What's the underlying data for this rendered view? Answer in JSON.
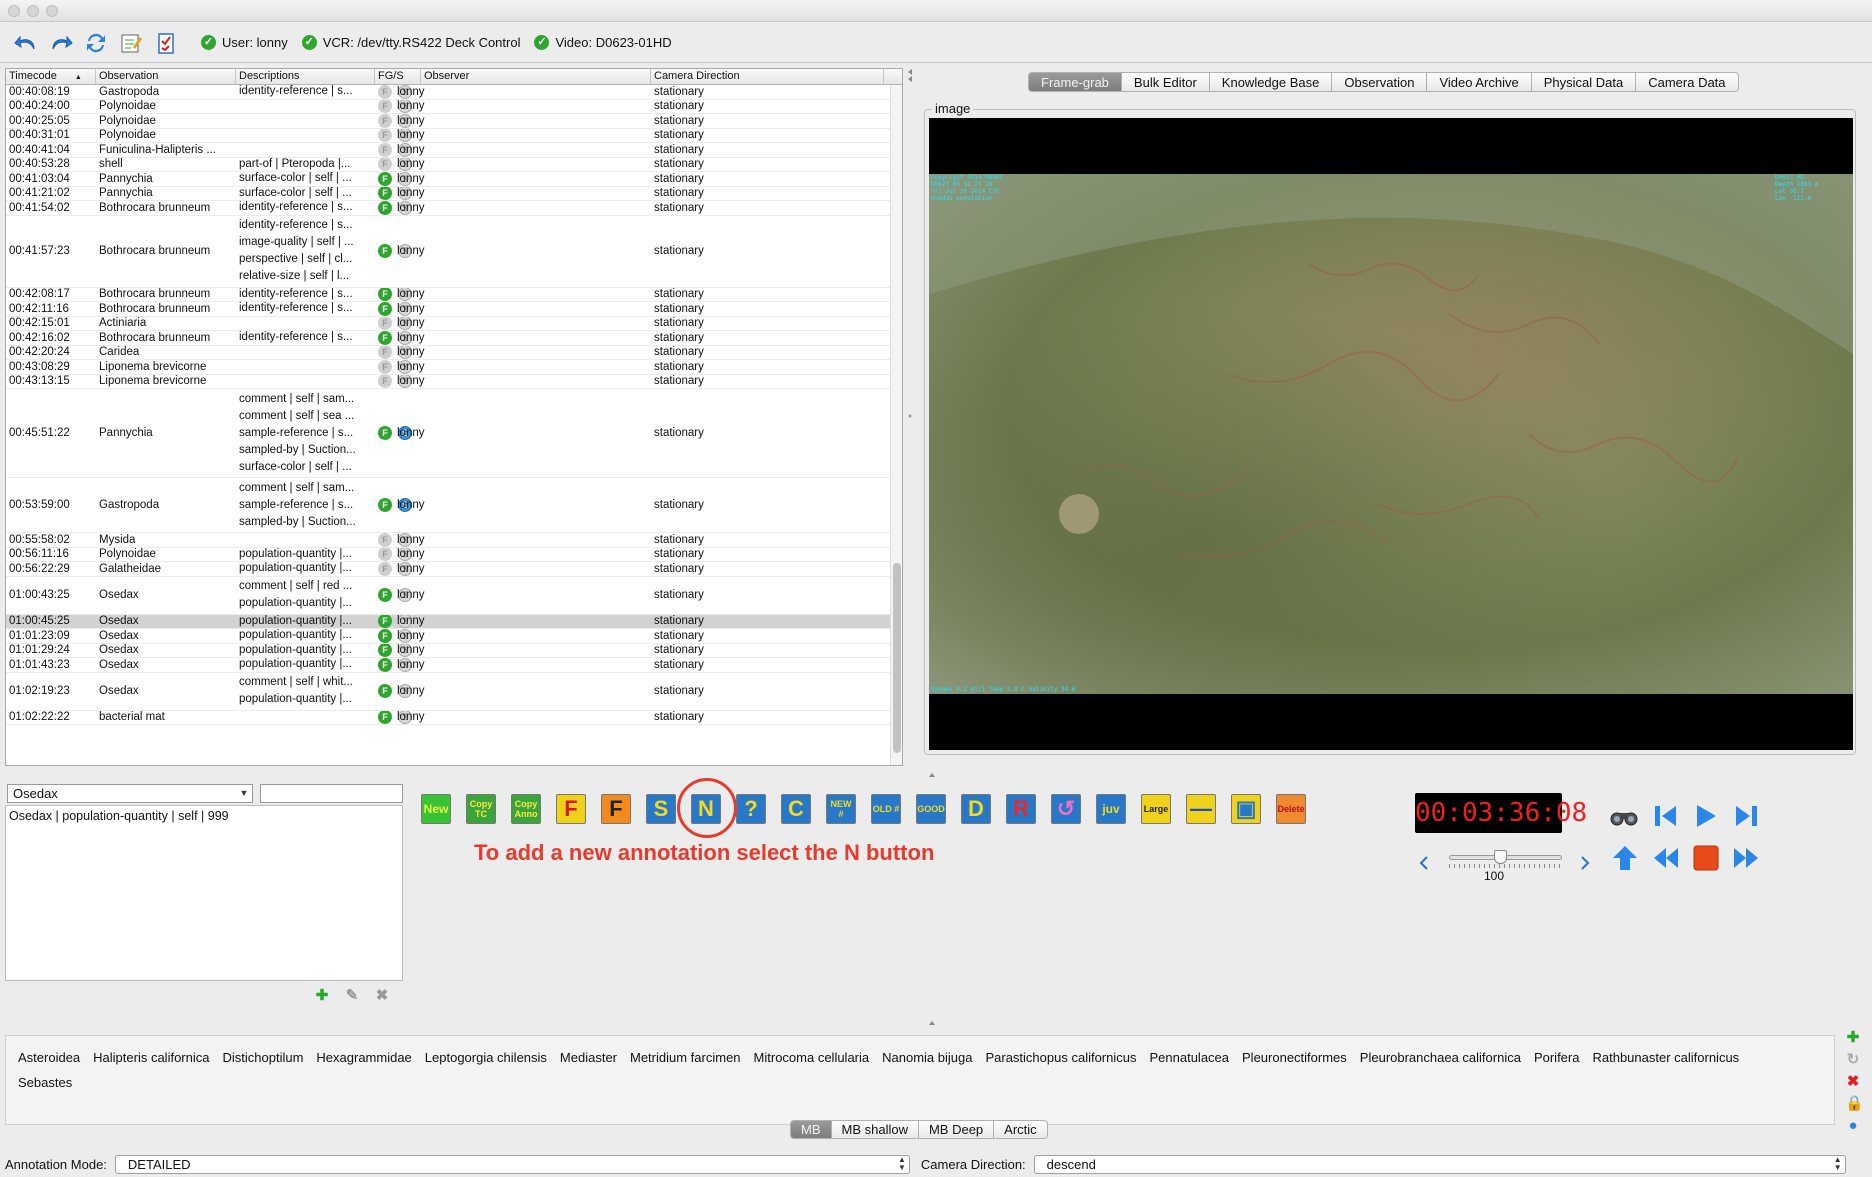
{
  "toolbar": {
    "user": "User: lonny",
    "vcr": "VCR: /dev/tty.RS422 Deck Control",
    "video": "Video: D0623-01HD"
  },
  "table": {
    "headers": [
      "Timecode",
      "Observation",
      "Descriptions",
      "FG/S",
      "Observer",
      "Camera Direction"
    ],
    "rows": [
      {
        "tc": "00:40:08:19",
        "obs": "Gastropoda",
        "desc": [
          "identity-reference | s..."
        ],
        "fg": false,
        "s": false,
        "observer": "lonny",
        "cam": "stationary"
      },
      {
        "tc": "00:40:24:00",
        "obs": "Polynoidae",
        "desc": [],
        "fg": false,
        "s": false,
        "observer": "lonny",
        "cam": "stationary"
      },
      {
        "tc": "00:40:25:05",
        "obs": "Polynoidae",
        "desc": [],
        "fg": false,
        "s": false,
        "observer": "lonny",
        "cam": "stationary"
      },
      {
        "tc": "00:40:31:01",
        "obs": "Polynoidae",
        "desc": [],
        "fg": false,
        "s": false,
        "observer": "lonny",
        "cam": "stationary"
      },
      {
        "tc": "00:40:41:04",
        "obs": "Funiculina-Halipteris ...",
        "desc": [],
        "fg": false,
        "s": false,
        "observer": "lonny",
        "cam": "stationary"
      },
      {
        "tc": "00:40:53:28",
        "obs": "shell",
        "desc": [
          "part-of | Pteropoda |..."
        ],
        "fg": false,
        "s": false,
        "observer": "lonny",
        "cam": "stationary"
      },
      {
        "tc": "00:41:03:04",
        "obs": "Pannychia",
        "desc": [
          "surface-color | self | ..."
        ],
        "fg": true,
        "s": false,
        "observer": "lonny",
        "cam": "stationary"
      },
      {
        "tc": "00:41:21:02",
        "obs": "Pannychia",
        "desc": [
          "surface-color | self | ..."
        ],
        "fg": true,
        "s": false,
        "observer": "lonny",
        "cam": "stationary"
      },
      {
        "tc": "00:41:54:02",
        "obs": "Bothrocara brunneum",
        "desc": [
          "identity-reference | s..."
        ],
        "fg": true,
        "s": false,
        "observer": "lonny",
        "cam": "stationary"
      },
      {
        "tc": "00:41:57:23",
        "obs": "Bothrocara brunneum",
        "desc": [
          "identity-reference | s...",
          "image-quality | self | ...",
          "perspective | self | cl...",
          "relative-size | self | l..."
        ],
        "fg": true,
        "s": false,
        "observer": "lonny",
        "cam": "stationary"
      },
      {
        "tc": "00:42:08:17",
        "obs": "Bothrocara brunneum",
        "desc": [
          "identity-reference | s..."
        ],
        "fg": true,
        "s": false,
        "observer": "lonny",
        "cam": "stationary"
      },
      {
        "tc": "00:42:11:16",
        "obs": "Bothrocara brunneum",
        "desc": [
          "identity-reference | s..."
        ],
        "fg": true,
        "s": false,
        "observer": "lonny",
        "cam": "stationary"
      },
      {
        "tc": "00:42:15:01",
        "obs": "Actiniaria",
        "desc": [],
        "fg": false,
        "s": false,
        "observer": "lonny",
        "cam": "stationary"
      },
      {
        "tc": "00:42:16:02",
        "obs": "Bothrocara brunneum",
        "desc": [
          "identity-reference | s..."
        ],
        "fg": true,
        "s": false,
        "observer": "lonny",
        "cam": "stationary"
      },
      {
        "tc": "00:42:20:24",
        "obs": "Caridea",
        "desc": [],
        "fg": false,
        "s": false,
        "observer": "lonny",
        "cam": "stationary"
      },
      {
        "tc": "00:43:08:29",
        "obs": "Liponema brevicorne",
        "desc": [],
        "fg": false,
        "s": false,
        "observer": "lonny",
        "cam": "stationary"
      },
      {
        "tc": "00:43:13:15",
        "obs": "Liponema brevicorne",
        "desc": [],
        "fg": false,
        "s": false,
        "observer": "lonny",
        "cam": "stationary"
      },
      {
        "tc": "00:45:51:22",
        "obs": "Pannychia",
        "desc": [
          "comment | self | sam...",
          "comment | self | sea ...",
          "sample-reference | s...",
          "sampled-by | Suction...",
          "surface-color | self | ..."
        ],
        "fg": true,
        "s": true,
        "observer": "lonny",
        "cam": "stationary"
      },
      {
        "tc": "00:53:59:00",
        "obs": "Gastropoda",
        "desc": [
          "comment | self | sam...",
          "sample-reference | s...",
          "sampled-by | Suction..."
        ],
        "fg": true,
        "s": true,
        "observer": "lonny",
        "cam": "stationary"
      },
      {
        "tc": "00:55:58:02",
        "obs": "Mysida",
        "desc": [],
        "fg": false,
        "s": false,
        "observer": "lonny",
        "cam": "stationary"
      },
      {
        "tc": "00:56:11:16",
        "obs": "Polynoidae",
        "desc": [
          "population-quantity |..."
        ],
        "fg": false,
        "s": false,
        "observer": "lonny",
        "cam": "stationary"
      },
      {
        "tc": "00:56:22:29",
        "obs": "Galatheidae",
        "desc": [
          "population-quantity |..."
        ],
        "fg": false,
        "s": false,
        "observer": "lonny",
        "cam": "stationary"
      },
      {
        "tc": "01:00:43:25",
        "obs": "Osedax",
        "desc": [
          "comment | self | red ...",
          "population-quantity |..."
        ],
        "fg": true,
        "s": false,
        "observer": "lonny",
        "cam": "stationary"
      },
      {
        "tc": "01:00:45:25",
        "obs": "Osedax",
        "desc": [
          "population-quantity |..."
        ],
        "fg": true,
        "s": false,
        "observer": "lonny",
        "cam": "stationary",
        "selected": true
      },
      {
        "tc": "01:01:23:09",
        "obs": "Osedax",
        "desc": [
          "population-quantity |..."
        ],
        "fg": true,
        "s": false,
        "observer": "lonny",
        "cam": "stationary"
      },
      {
        "tc": "01:01:29:24",
        "obs": "Osedax",
        "desc": [
          "population-quantity |..."
        ],
        "fg": true,
        "s": false,
        "observer": "lonny",
        "cam": "stationary"
      },
      {
        "tc": "01:01:43:23",
        "obs": "Osedax",
        "desc": [
          "population-quantity |..."
        ],
        "fg": true,
        "s": false,
        "observer": "lonny",
        "cam": "stationary"
      },
      {
        "tc": "01:02:19:23",
        "obs": "Osedax",
        "desc": [
          "comment | self | whit...",
          "population-quantity |..."
        ],
        "fg": true,
        "s": false,
        "observer": "lonny",
        "cam": "stationary"
      },
      {
        "tc": "01:02:22:22",
        "obs": "bacterial mat",
        "desc": [],
        "fg": true,
        "s": false,
        "observer": "lonny",
        "cam": "stationary"
      }
    ]
  },
  "tabs": [
    "Frame-grab",
    "Bulk Editor",
    "Knowledge Base",
    "Observation",
    "Video Archive",
    "Physical Data",
    "Camera Data"
  ],
  "image_label": "image",
  "editor": {
    "concept_value": "Osedax",
    "search_value": "",
    "associations": [
      "Osedax | population-quantity | self | 999"
    ]
  },
  "annotation_buttons": [
    {
      "name": "new-button",
      "label": "New",
      "bg": "#38c238",
      "fg": "#e8ff40"
    },
    {
      "name": "copy-tc-button",
      "label": "Copy TC",
      "bg": "#3aa53a",
      "fg": "#ffe640"
    },
    {
      "name": "copy-anno-button",
      "label": "Copy Anno",
      "bg": "#3aa53a",
      "fg": "#ffe640"
    },
    {
      "name": "framegrab-button",
      "label": "F",
      "bg": "#f1d21a",
      "fg": "#d81818"
    },
    {
      "name": "framegrab-delete-button",
      "label": "F",
      "bg": "#f38a1e",
      "fg": "#222"
    },
    {
      "name": "sample-button",
      "label": "S",
      "bg": "#2778c8",
      "fg": "#f6d820"
    },
    {
      "name": "nothing-button",
      "label": "N",
      "bg": "#2778c8",
      "fg": "#f6d820"
    },
    {
      "name": "question-button",
      "label": "?",
      "bg": "#2778c8",
      "fg": "#f6d820"
    },
    {
      "name": "comment-button",
      "label": "C",
      "bg": "#2778c8",
      "fg": "#f6d820"
    },
    {
      "name": "new-number-button",
      "label": "NEW #",
      "bg": "#2778c8",
      "fg": "#f6d820"
    },
    {
      "name": "old-number-button",
      "label": "OLD #",
      "bg": "#2778c8",
      "fg": "#f6d820"
    },
    {
      "name": "good-button",
      "label": "GOOD",
      "bg": "#2778c8",
      "fg": "#f6d820"
    },
    {
      "name": "dead-button",
      "label": "D",
      "bg": "#2778c8",
      "fg": "#f6d820"
    },
    {
      "name": "r-button",
      "label": "R",
      "bg": "#2778c8",
      "fg": "#e82828"
    },
    {
      "name": "link-button",
      "label": "↺",
      "bg": "#2778c8",
      "fg": "#f070c0"
    },
    {
      "name": "juvenile-button",
      "label": "juv",
      "bg": "#2778c8",
      "fg": "#f6d820"
    },
    {
      "name": "large-button",
      "label": "Large",
      "bg": "#f1d21a",
      "fg": "#222"
    },
    {
      "name": "underline-button",
      "label": "―",
      "bg": "#f1d21a",
      "fg": "#2050c0"
    },
    {
      "name": "image-button",
      "label": "▣",
      "bg": "#f1d21a",
      "fg": "#2778c8"
    },
    {
      "name": "delete-button",
      "label": "Delete",
      "bg": "#f08a30",
      "fg": "#c01010"
    }
  ],
  "instruction": "To add a new annotation select the N button",
  "vcr": {
    "timecode": "00:03:36:08",
    "speed": "100",
    "speed_fraction": 0.45
  },
  "concepts": [
    "Asteroidea",
    "Halipteris californica",
    "Distichoptilum",
    "Hexagrammidae",
    "Leptogorgia chilensis",
    "Mediaster",
    "Metridium farcimen",
    "Mitrocoma cellularia",
    "Nanomia bijuga",
    "Parastichopus californicus",
    "Pennatulacea",
    "Pleuronectiformes",
    "Pleurobranchaea californica",
    "Porifera",
    "Rathbunaster californicus",
    "Sebastes"
  ],
  "concept_tabs": [
    "MB",
    "MB shallow",
    "MB Deep",
    "Arctic"
  ],
  "status": {
    "annotation_mode_label": "Annotation Mode:",
    "annotation_mode_value": "DETAILED",
    "camera_direction_label": "Camera Direction:",
    "camera_direction_value": "descend"
  },
  "colors": {
    "accent_red": "#e53a2c",
    "timecode_red": "#f02020",
    "check_green": "#2ea62e"
  }
}
